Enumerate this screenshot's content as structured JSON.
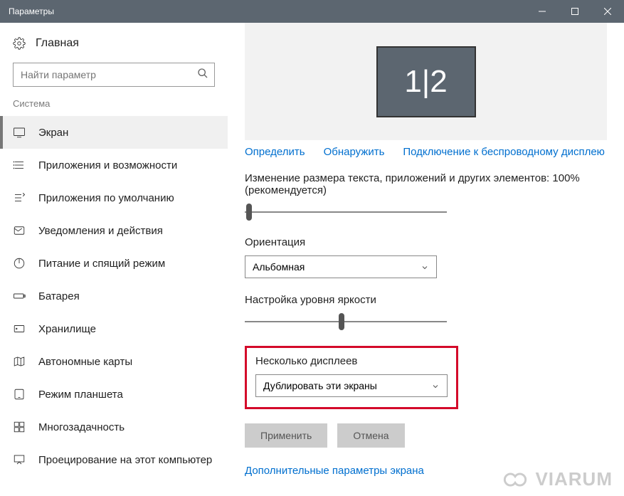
{
  "window_title": "Параметры",
  "home_label": "Главная",
  "search_placeholder": "Найти параметр",
  "section_label": "Система",
  "nav": [
    "Экран",
    "Приложения и возможности",
    "Приложения по умолчанию",
    "Уведомления и действия",
    "Питание и спящий режим",
    "Батарея",
    "Хранилище",
    "Автономные карты",
    "Режим планшета",
    "Многозадачность",
    "Проецирование на этот компьютер"
  ],
  "monitor_label": "1|2",
  "links": {
    "identify": "Определить",
    "detect": "Обнаружить",
    "wireless": "Подключение к беспроводному дисплею"
  },
  "scale_label": "Изменение размера текста, приложений и других элементов: 100% (рекомендуется)",
  "orientation_label": "Ориентация",
  "orientation_value": "Альбомная",
  "brightness_label": "Настройка уровня яркости",
  "multidisplay_label": "Несколько дисплеев",
  "multidisplay_value": "Дублировать эти экраны",
  "apply_label": "Применить",
  "cancel_label": "Отмена",
  "advanced_label": "Дополнительные параметры экрана",
  "watermark": "VIARUM"
}
